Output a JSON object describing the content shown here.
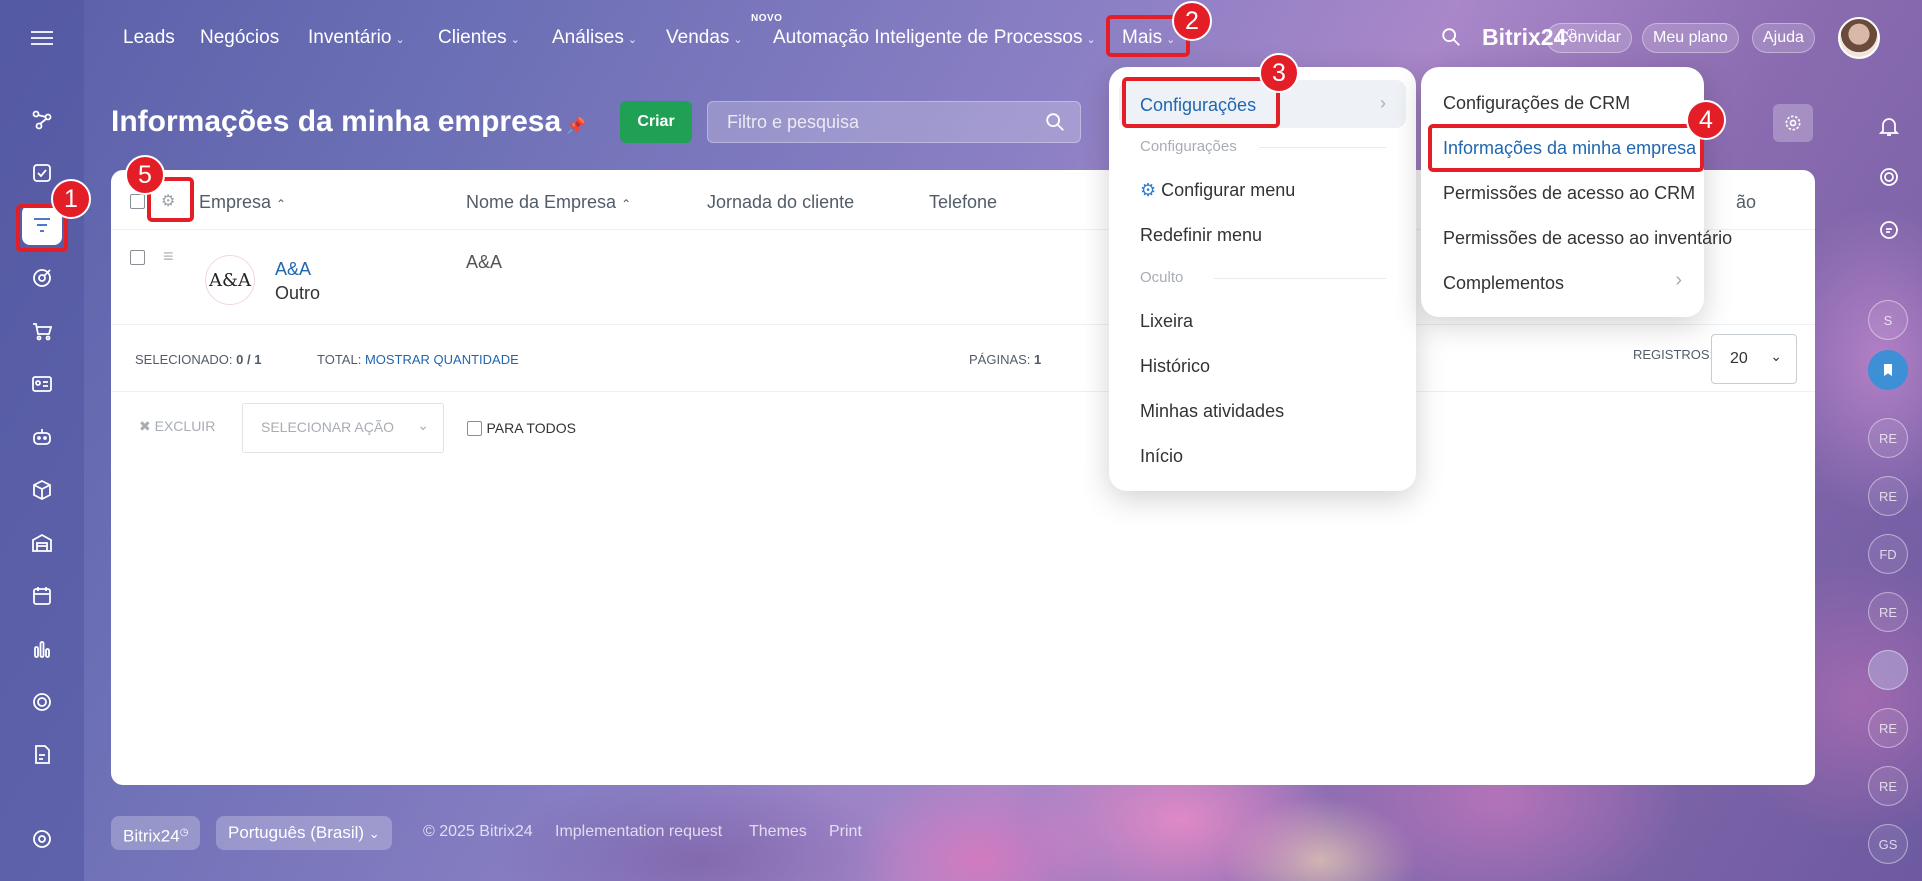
{
  "nav": {
    "items": [
      {
        "label": "Leads"
      },
      {
        "label": "Negócios"
      },
      {
        "label": "Inventário"
      },
      {
        "label": "Clientes"
      },
      {
        "label": "Análises"
      },
      {
        "label": "Vendas"
      },
      {
        "label": "Automação Inteligente de Processos"
      },
      {
        "label": "Mais"
      }
    ],
    "novo_badge": "NOVO",
    "brand": "Bitrix24",
    "invite": "Convidar",
    "my_plan": "Meu plano",
    "help": "Ajuda"
  },
  "page": {
    "title": "Informações da minha empresa",
    "create_button": "Criar",
    "filter_placeholder": "Filtro e pesquisa"
  },
  "table": {
    "columns": [
      "Empresa",
      "Nome da Empresa",
      "Jornada do cliente",
      "Telefone"
    ],
    "partial_column": "ão",
    "rows": [
      {
        "company": "A&A",
        "type": "Outro",
        "name": "A&A",
        "logo_text": "A&A"
      }
    ],
    "selected_label": "SELECIONADO:",
    "selected_value": "0 / 1",
    "total_label": "TOTAL:",
    "total_link": "MOSTRAR QUANTIDADE",
    "pages_label": "PÁGINAS:",
    "pages_value": "1",
    "records_label": "REGISTROS:",
    "records_value": "20",
    "delete_label": "EXCLUIR",
    "action_placeholder": "SELECIONAR AÇÃO",
    "for_all_label": "PARA TODOS"
  },
  "menu_mais": {
    "items": [
      {
        "label": "Configurações",
        "highlighted": true
      },
      {
        "label": "Configurações",
        "section": true
      },
      {
        "label": "Configurar menu"
      },
      {
        "label": "Redefinir menu"
      },
      {
        "label": "Oculto",
        "section": true
      },
      {
        "label": "Lixeira"
      },
      {
        "label": "Histórico"
      },
      {
        "label": "Minhas atividades"
      },
      {
        "label": "Início"
      }
    ]
  },
  "submenu_config": {
    "items": [
      {
        "label": "Configurações de CRM"
      },
      {
        "label": "Informações da minha empresa",
        "active": true
      },
      {
        "label": "Permissões de acesso ao CRM"
      },
      {
        "label": "Permissões de acesso ao inventário"
      },
      {
        "label": "Complementos"
      }
    ]
  },
  "right_bar": {
    "avatars": [
      "S",
      "RE",
      "RE",
      "FD",
      "RE",
      "RE",
      "RE",
      "GS"
    ]
  },
  "footer": {
    "brand": "Bitrix24",
    "language": "Português (Brasil)",
    "copyright": "© 2025 Bitrix24",
    "links": [
      "Implementation request",
      "Themes",
      "Print"
    ]
  },
  "annotations": [
    "1",
    "2",
    "3",
    "4",
    "5"
  ],
  "colors": {
    "accent_link": "#2067b0",
    "create_green": "#1fa055",
    "annotation_red": "#e41e26"
  }
}
